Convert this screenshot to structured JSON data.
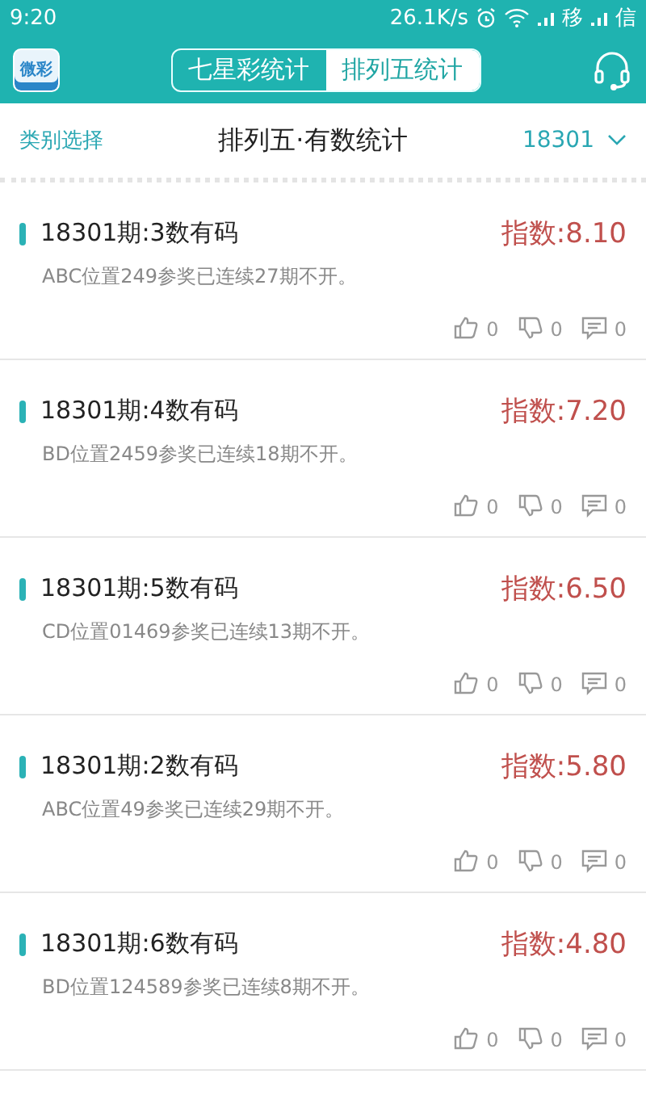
{
  "status_bar": {
    "time": "9:20",
    "speed": "26.1K/s",
    "carrier_1": "移",
    "carrier_2": "信"
  },
  "header": {
    "logo_text": "微彩",
    "tabs": [
      {
        "label": "七星彩统计",
        "selected": false
      },
      {
        "label": "排列五统计",
        "selected": true
      }
    ]
  },
  "subheader": {
    "category": "类别选择",
    "title": "排列五·有数统计",
    "issue": "18301"
  },
  "cards": [
    {
      "title": "18301期:3数有码",
      "index": "指数:8.10",
      "detail": "ABC位置249参奖已连续27期不开。",
      "likes": "0",
      "dislikes": "0",
      "comments": "0"
    },
    {
      "title": "18301期:4数有码",
      "index": "指数:7.20",
      "detail": "BD位置2459参奖已连续18期不开。",
      "likes": "0",
      "dislikes": "0",
      "comments": "0"
    },
    {
      "title": "18301期:5数有码",
      "index": "指数:6.50",
      "detail": "CD位置01469参奖已连续13期不开。",
      "likes": "0",
      "dislikes": "0",
      "comments": "0"
    },
    {
      "title": "18301期:2数有码",
      "index": "指数:5.80",
      "detail": "ABC位置49参奖已连续29期不开。",
      "likes": "0",
      "dislikes": "0",
      "comments": "0"
    },
    {
      "title": "18301期:6数有码",
      "index": "指数:4.80",
      "detail": "BD位置124589参奖已连续8期不开。",
      "likes": "0",
      "dislikes": "0",
      "comments": "0"
    }
  ]
}
